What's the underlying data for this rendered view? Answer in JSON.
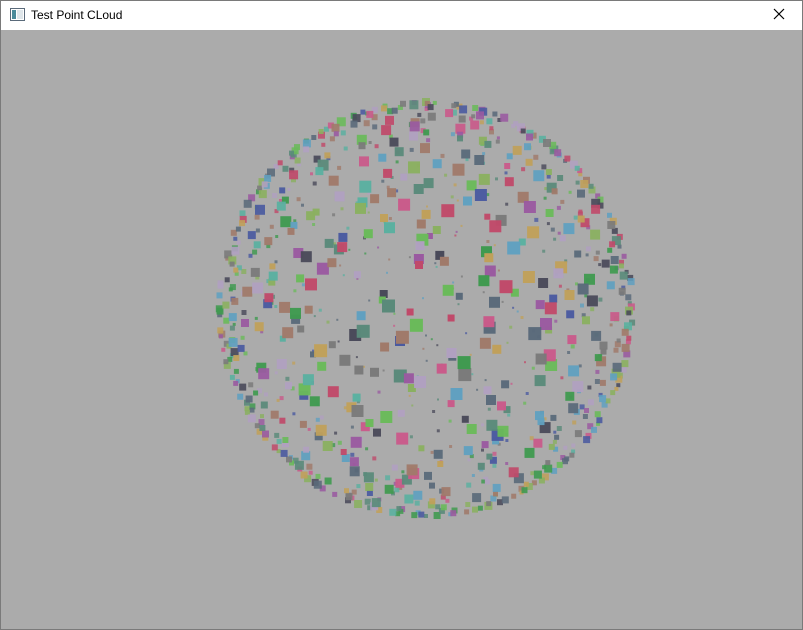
{
  "window": {
    "title": "Test Point CLoud",
    "icon": "app-window-icon",
    "close_icon": "close-icon"
  },
  "viewport": {
    "background": "#ababab",
    "point_cloud": {
      "shape": "sphere",
      "palette": [
        "#3f9a4f",
        "#5a8a7a",
        "#c95a8a",
        "#4a5aa0",
        "#6aba5a",
        "#a07a6a",
        "#5ab0a0",
        "#9a5aa0",
        "#c0a05a",
        "#4a4a5a",
        "#7a7a7a",
        "#b0a0c0",
        "#5a6a7a",
        "#8ab060",
        "#c04a6a",
        "#60a0c0"
      ]
    }
  }
}
